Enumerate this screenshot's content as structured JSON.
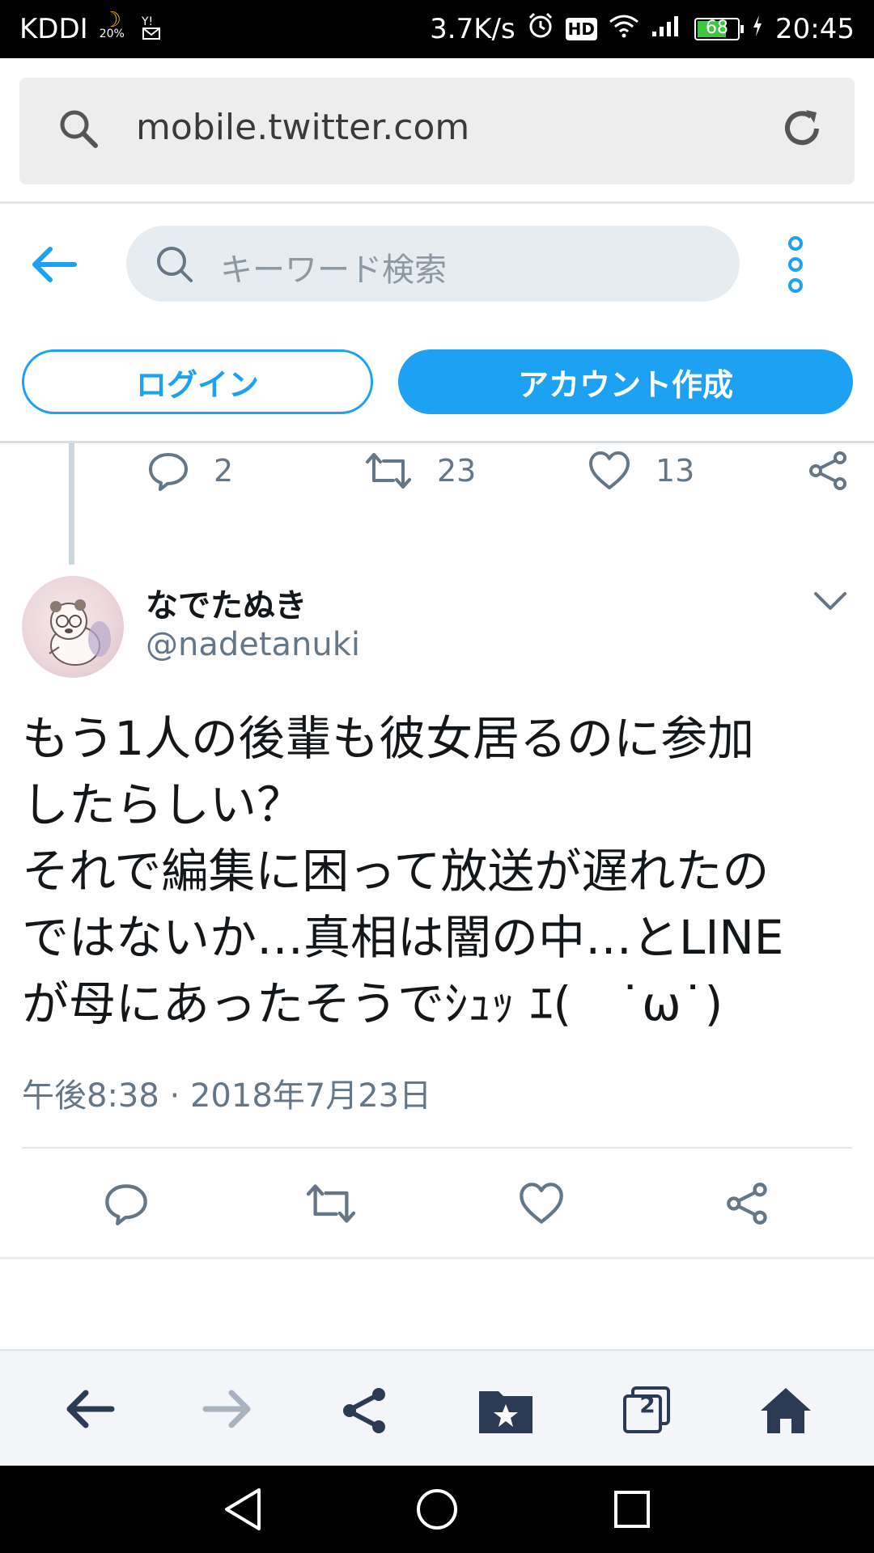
{
  "status_bar": {
    "carrier": "KDDI",
    "moon_percent": "20%",
    "network_speed": "3.7K/s",
    "hd_label": "HD",
    "battery_level": "68",
    "time": "20:45"
  },
  "browser": {
    "url": "mobile.twitter.com",
    "tab_count": "2"
  },
  "twitter_header": {
    "search_placeholder": "キーワード検索",
    "login_label": "ログイン",
    "signup_label": "アカウント作成"
  },
  "previous_tweet": {
    "reply_count": "2",
    "retweet_count": "23",
    "like_count": "13"
  },
  "tweet": {
    "display_name": "なでたぬき",
    "username": "@nadetanuki",
    "text": "もう1人の後輩も彼女居るのに参加\nしたらしい？\nそれで編集に困って放送が遅れたの\nではないか…真相は闇の中…とLINE\nが母にあったそうでｼｭｯ ｴ(　˙ω˙)",
    "timestamp": "午後8:38 · 2018年7月23日"
  },
  "colors": {
    "twitter_blue": "#1da1f2",
    "secondary_text": "#657786",
    "toolbar_icon": "#2b3a55"
  }
}
